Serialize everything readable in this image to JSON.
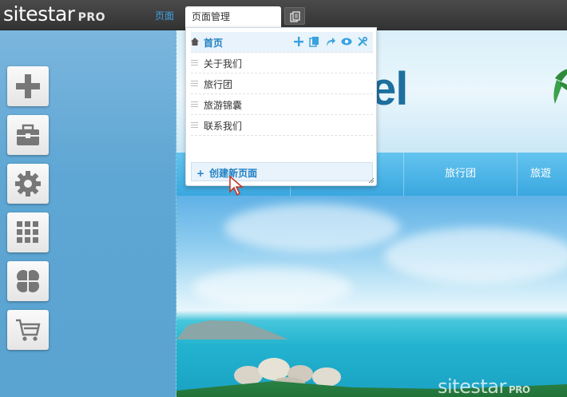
{
  "topbar": {
    "logo_text": "sitestar",
    "logo_badge": "PRO",
    "nav_page": "页面",
    "tab_page_manage": "页面管理"
  },
  "sidebar": {
    "tools": [
      {
        "icon": "plus-icon"
      },
      {
        "icon": "toolbox-icon"
      },
      {
        "icon": "gear-icon"
      },
      {
        "icon": "grid-icon"
      },
      {
        "icon": "clover-icon"
      },
      {
        "icon": "cart-icon"
      }
    ]
  },
  "page_manager": {
    "pages": [
      {
        "label": "首页",
        "home": true
      },
      {
        "label": "关于我们"
      },
      {
        "label": "旅行团"
      },
      {
        "label": "旅游锦囊"
      },
      {
        "label": "联系我们"
      }
    ],
    "actions": [
      "add-icon",
      "copy-icon",
      "redirect-icon",
      "preview-icon",
      "settings-icon"
    ],
    "create_label": "创建新页面",
    "create_plus": "+"
  },
  "site": {
    "title_fragment": "el",
    "menu": [
      "旅行团",
      "旅遊"
    ]
  },
  "watermark": {
    "text": "sitestar",
    "badge": "PRO"
  },
  "colors": {
    "accent": "#1e7fc4",
    "menu_bar": "#3aa7df",
    "title": "#1d6f9e"
  }
}
